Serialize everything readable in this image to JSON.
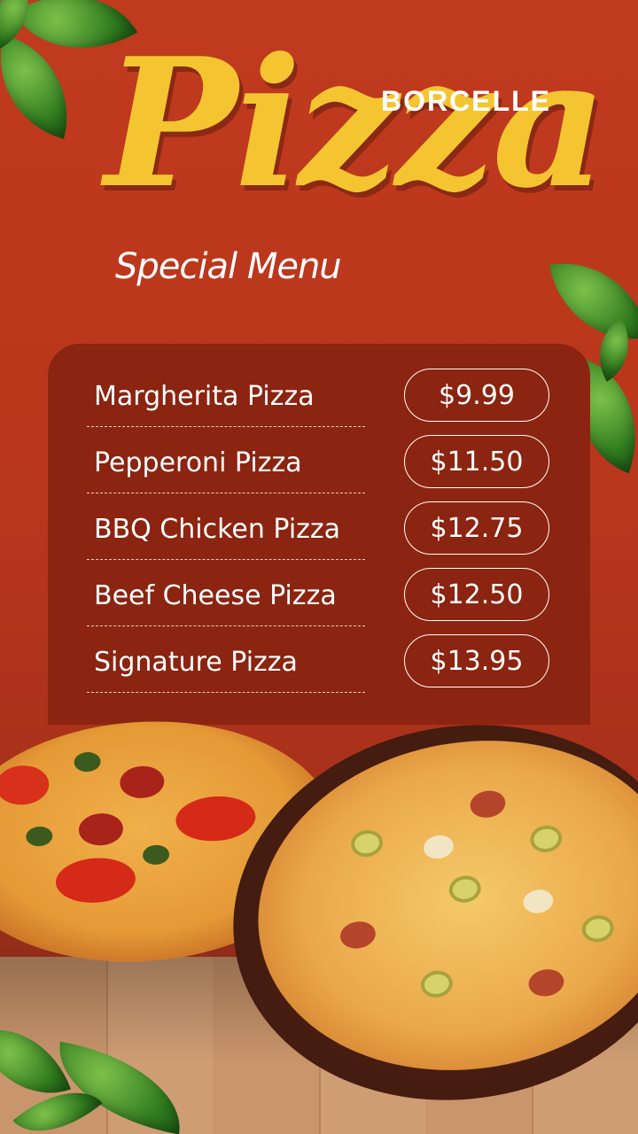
{
  "brand": "BORCELLE",
  "title": "Pizza",
  "subtitle": "Special Menu",
  "menu": [
    {
      "name": "Margherita Pizza",
      "price": "$9.99"
    },
    {
      "name": "Pepperoni Pizza",
      "price": "$11.50"
    },
    {
      "name": "BBQ Chicken Pizza",
      "price": "$12.75"
    },
    {
      "name": "Beef Cheese Pizza",
      "price": "$12.50"
    },
    {
      "name": "Signature Pizza",
      "price": "$13.95"
    }
  ],
  "colors": {
    "background": "#b8361c",
    "title_yellow": "#f4c531",
    "menu_card": "#8b2410",
    "text": "#ffffff"
  },
  "icons": [
    "basil-leaf-icon",
    "pizza-image",
    "wooden-table-image"
  ]
}
